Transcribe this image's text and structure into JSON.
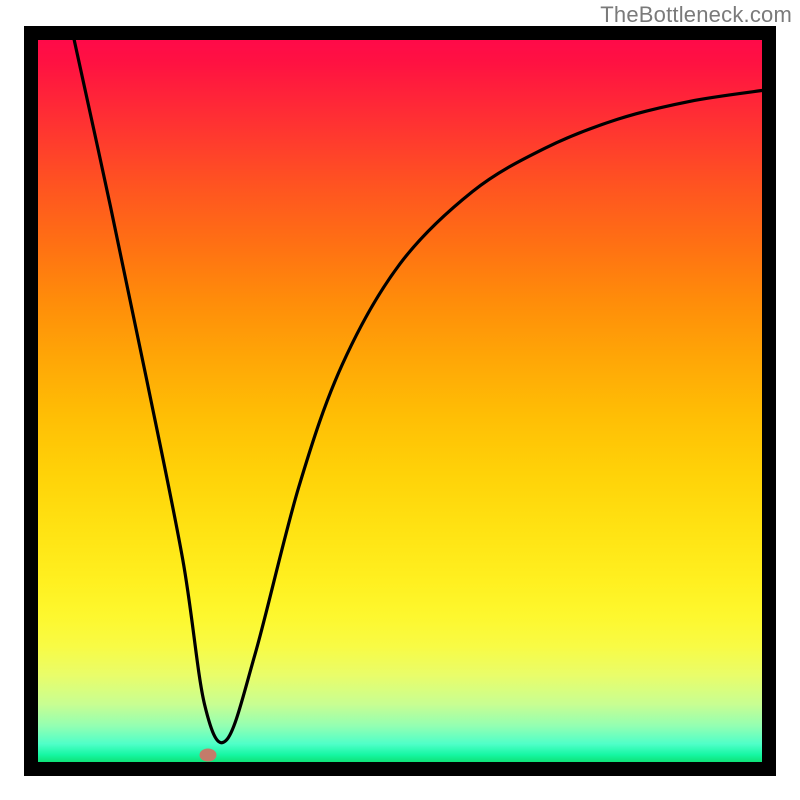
{
  "watermark": "TheBottleneck.com",
  "chart_data": {
    "type": "line",
    "title": "",
    "xlabel": "",
    "ylabel": "",
    "xlim": [
      0,
      100
    ],
    "ylim": [
      0,
      100
    ],
    "grid": false,
    "legend": false,
    "series": [
      {
        "name": "curve",
        "x": [
          5,
          10,
          15,
          20,
          23,
          26,
          30,
          36,
          42,
          50,
          60,
          70,
          80,
          90,
          100
        ],
        "values": [
          100,
          77,
          53,
          28,
          8,
          3,
          15,
          38,
          55,
          69,
          79,
          85,
          89,
          91.5,
          93
        ]
      }
    ],
    "marker": {
      "x": 23.5,
      "y": 1.0,
      "color": "#c47b6a"
    },
    "colors": {
      "curve": "#000000",
      "background_top": "#ff0a49",
      "background_bottom": "#0ee277",
      "frame": "#000000"
    }
  }
}
